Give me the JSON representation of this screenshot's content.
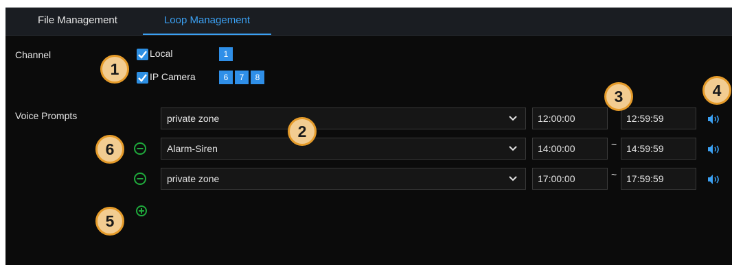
{
  "tabs": [
    {
      "label": "File Management",
      "active": false
    },
    {
      "label": "Loop Management",
      "active": true
    }
  ],
  "channel": {
    "label": "Channel",
    "local": {
      "label": "Local",
      "checked": true,
      "channels": [
        "1"
      ]
    },
    "ip_camera": {
      "label": "IP Camera",
      "checked": true,
      "channels": [
        "6",
        "7",
        "8"
      ]
    }
  },
  "voice_prompts": {
    "label": "Voice Prompts",
    "rows": [
      {
        "prompt": "private zone",
        "start": "12:00:00",
        "end": "12:59:59",
        "removable": false
      },
      {
        "prompt": "Alarm-Siren",
        "start": "14:00:00",
        "end": "14:59:59",
        "removable": true
      },
      {
        "prompt": "private zone",
        "start": "17:00:00",
        "end": "17:59:59",
        "removable": true
      }
    ],
    "separator": "~"
  },
  "callouts": [
    "1",
    "2",
    "3",
    "4",
    "5",
    "6"
  ],
  "colors": {
    "accent": "#3ba0f2",
    "checkbox": "#2d8fe3",
    "remove_add_icon": "#1faa3c",
    "badge_fill": "#f2cc91",
    "badge_border": "#e59b2a"
  },
  "icons": {
    "dropdown": "chevron-down-icon",
    "speaker": "speaker-icon",
    "remove": "minus-circle-icon",
    "add": "plus-circle-icon",
    "check": "checkmark-icon"
  }
}
